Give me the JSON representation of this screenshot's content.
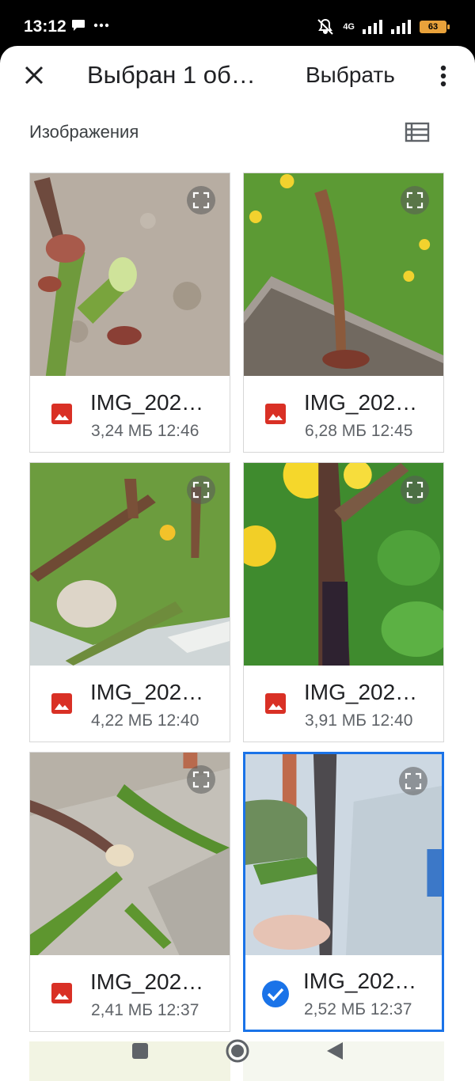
{
  "status_bar": {
    "time": "13:12",
    "network": "4G",
    "battery": "63"
  },
  "header": {
    "title": "Выбран 1 об…",
    "select_label": "Выбрать"
  },
  "section": {
    "title": "Изображения"
  },
  "files": [
    {
      "name": "IMG_202…",
      "meta": "3,24 МБ 12:46",
      "selected": false
    },
    {
      "name": "IMG_202…",
      "meta": "6,28 МБ 12:45",
      "selected": false
    },
    {
      "name": "IMG_202…",
      "meta": "4,22 МБ 12:40",
      "selected": false
    },
    {
      "name": "IMG_202…",
      "meta": "3,91 МБ 12:40",
      "selected": false
    },
    {
      "name": "IMG_202…",
      "meta": "2,41 МБ 12:37",
      "selected": false
    },
    {
      "name": "IMG_202…",
      "meta": "2,52 МБ 12:37",
      "selected": true
    }
  ],
  "colors": {
    "accent": "#1a73e8",
    "image_icon": "#d93025",
    "battery": "#e9a23b"
  },
  "icons": [
    "close-icon",
    "more-vert-icon",
    "list-view-icon",
    "expand-icon",
    "image-file-icon",
    "check-circle-icon"
  ]
}
